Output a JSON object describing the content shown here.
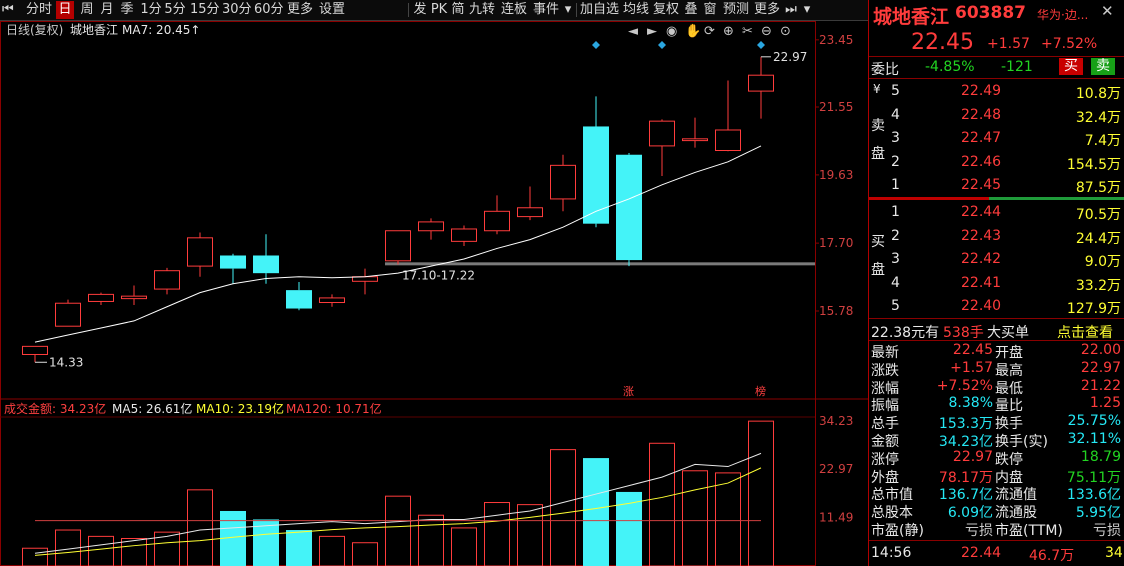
{
  "toolbar": {
    "periods": [
      "分时",
      "日",
      "周",
      "月",
      "季",
      "1分",
      "5分",
      "15分",
      "30分",
      "60分",
      "更多",
      "设置"
    ],
    "active_period": "日",
    "tools": [
      "发",
      "PK",
      "简",
      "九转",
      "连板",
      "事件",
      "▾",
      "加自选",
      "均线",
      "复权",
      "叠",
      "窗",
      "预测",
      "更多"
    ]
  },
  "chart": {
    "mode_label": "日线(复权)",
    "stock_name": "城地香江",
    "ma_label": "MA7: 20.45↑",
    "price_ticks": [
      "23.45",
      "21.55",
      "19.63",
      "17.70",
      "15.78"
    ],
    "high_label": "22.97",
    "low_label": "14.33",
    "gap_label": "17.10-17.22",
    "markers": [
      "涨",
      "榜"
    ],
    "vol_ticks": [
      "34.23",
      "22.97",
      "11.49"
    ],
    "vol_legend": {
      "label": "成交金额: 34.23亿",
      "ma5": "MA5: 26.61亿",
      "ma10": "MA10: 23.19亿",
      "ma120": "MA120: 10.71亿"
    },
    "colors": {
      "up": "#ff3c3c",
      "down": "#44f3f8",
      "ma": "#ffffff",
      "ma10": "#ffff33",
      "gap": "#7a7a7a"
    }
  },
  "chart_data": {
    "type": "candlestick",
    "title": "城地香江",
    "ylim": [
      14.3,
      23.45
    ],
    "candles": [
      {
        "o": 14.55,
        "h": 14.75,
        "l": 14.33,
        "c": 14.78
      },
      {
        "o": 15.35,
        "h": 16.1,
        "l": 15.35,
        "c": 16.0
      },
      {
        "o": 16.05,
        "h": 16.3,
        "l": 15.95,
        "c": 16.25
      },
      {
        "o": 16.13,
        "h": 16.5,
        "l": 15.95,
        "c": 16.2
      },
      {
        "o": 16.4,
        "h": 17.0,
        "l": 16.25,
        "c": 16.92
      },
      {
        "o": 17.05,
        "h": 18.0,
        "l": 16.75,
        "c": 17.85
      },
      {
        "o": 17.35,
        "h": 17.4,
        "l": 16.55,
        "c": 16.98
      },
      {
        "o": 17.35,
        "h": 17.95,
        "l": 16.55,
        "c": 16.85
      },
      {
        "o": 16.37,
        "h": 16.6,
        "l": 15.8,
        "c": 15.85
      },
      {
        "o": 16.02,
        "h": 16.25,
        "l": 15.9,
        "c": 16.15
      },
      {
        "o": 16.62,
        "h": 16.98,
        "l": 16.25,
        "c": 16.75
      },
      {
        "o": 17.2,
        "h": 18.05,
        "l": 17.1,
        "c": 18.05
      },
      {
        "o": 18.05,
        "h": 18.4,
        "l": 17.8,
        "c": 18.3
      },
      {
        "o": 17.75,
        "h": 18.2,
        "l": 17.62,
        "c": 18.1
      },
      {
        "o": 18.05,
        "h": 19.05,
        "l": 17.95,
        "c": 18.6
      },
      {
        "o": 18.45,
        "h": 19.3,
        "l": 18.35,
        "c": 18.7
      },
      {
        "o": 18.95,
        "h": 20.2,
        "l": 18.6,
        "c": 19.9
      },
      {
        "o": 21.0,
        "h": 21.85,
        "l": 18.15,
        "c": 18.25
      },
      {
        "o": 20.2,
        "h": 20.25,
        "l": 17.05,
        "c": 17.22
      },
      {
        "o": 20.45,
        "h": 21.2,
        "l": 19.6,
        "c": 21.15
      },
      {
        "o": 20.6,
        "h": 21.25,
        "l": 20.4,
        "c": 20.65
      },
      {
        "o": 20.32,
        "h": 22.3,
        "l": 20.3,
        "c": 20.9
      },
      {
        "o": 22.0,
        "h": 22.97,
        "l": 21.22,
        "c": 22.45
      }
    ],
    "ma7": [
      14.9,
      15.1,
      15.3,
      15.5,
      15.9,
      16.3,
      16.55,
      16.7,
      16.75,
      16.72,
      16.75,
      16.85,
      17.05,
      17.25,
      17.55,
      17.8,
      18.15,
      18.6,
      18.95,
      19.35,
      19.7,
      20.0,
      20.45
    ],
    "volume": [
      4.2,
      8.5,
      7.0,
      6.5,
      8.0,
      18.0,
      13.0,
      11.0,
      8.5,
      7.0,
      5.5,
      16.5,
      12.0,
      9.0,
      15.0,
      14.5,
      27.5,
      25.5,
      17.5,
      29.0,
      22.5,
      22.0,
      34.23
    ],
    "vol_ma5": [
      3.0,
      4.0,
      5.0,
      6.0,
      7.0,
      8.5,
      9.0,
      9.5,
      10.0,
      10.5,
      10.0,
      10.5,
      11.0,
      11.0,
      12.0,
      13.0,
      15.0,
      17.0,
      19.0,
      21.0,
      24.0,
      23.5,
      26.61
    ],
    "vol_ma10": [
      2.5,
      3.2,
      4.0,
      4.8,
      5.5,
      6.0,
      6.8,
      7.5,
      8.0,
      8.6,
      9.0,
      9.3,
      9.7,
      10.0,
      10.6,
      11.5,
      12.5,
      13.6,
      14.8,
      16.2,
      18.0,
      19.6,
      23.19
    ],
    "vol_ma120": [
      10.71
    ]
  },
  "quote": {
    "name": "城地香江",
    "code": "603887",
    "sector": "华为·边...",
    "price": "22.45",
    "change": "+1.57",
    "change_pct": "+7.52%",
    "weibi_label": "委比",
    "weibi_pct": "-4.85%",
    "weibi_diff": "-121",
    "buy_btn": "买",
    "sell_btn": "卖",
    "ask_label": "卖盘",
    "bid_label": "买盘",
    "asks": [
      {
        "lvl": "5",
        "price": "22.49",
        "vol": "10.8万"
      },
      {
        "lvl": "4",
        "price": "22.48",
        "vol": "32.4万"
      },
      {
        "lvl": "3",
        "price": "22.47",
        "vol": "7.4万"
      },
      {
        "lvl": "2",
        "price": "22.46",
        "vol": "154.5万"
      },
      {
        "lvl": "1",
        "price": "22.45",
        "vol": "87.5万"
      }
    ],
    "bids": [
      {
        "lvl": "1",
        "price": "22.44",
        "vol": "70.5万"
      },
      {
        "lvl": "2",
        "price": "22.43",
        "vol": "24.4万"
      },
      {
        "lvl": "3",
        "price": "22.42",
        "vol": "9.0万"
      },
      {
        "lvl": "4",
        "price": "22.41",
        "vol": "33.2万"
      },
      {
        "lvl": "5",
        "price": "22.40",
        "vol": "127.9万"
      }
    ],
    "big_order": {
      "price": "22.38元有",
      "hands": "538手",
      "label": "大买单",
      "link": "点击查看"
    },
    "stats": [
      {
        "k1": "最新",
        "v1": "22.45",
        "c1": "red",
        "k2": "开盘",
        "v2": "22.00",
        "c2": "red"
      },
      {
        "k1": "涨跌",
        "v1": "+1.57",
        "c1": "red",
        "k2": "最高",
        "v2": "22.97",
        "c2": "red"
      },
      {
        "k1": "涨幅",
        "v1": "+7.52%",
        "c1": "red",
        "k2": "最低",
        "v2": "21.22",
        "c2": "red"
      },
      {
        "k1": "振幅",
        "v1": "8.38%",
        "c1": "cyan",
        "k2": "量比",
        "v2": "1.25",
        "c2": "red"
      },
      {
        "k1": "总手",
        "v1": "153.3万",
        "c1": "cyan",
        "k2": "换手",
        "v2": "25.75%",
        "c2": "cyan"
      },
      {
        "k1": "金额",
        "v1": "34.23亿",
        "c1": "cyan",
        "k2": "换手(实)",
        "v2": "32.11%",
        "c2": "cyan"
      },
      {
        "k1": "涨停",
        "v1": "22.97",
        "c1": "red",
        "k2": "跌停",
        "v2": "18.79",
        "c2": "green"
      },
      {
        "k1": "外盘",
        "v1": "78.17万",
        "c1": "red",
        "k2": "内盘",
        "v2": "75.11万",
        "c2": "green"
      },
      {
        "k1": "总市值",
        "v1": "136.7亿",
        "c1": "cyan",
        "k2": "流通值",
        "v2": "133.6亿",
        "c2": "cyan"
      },
      {
        "k1": "总股本",
        "v1": "6.09亿",
        "c1": "cyan",
        "k2": "流通股",
        "v2": "5.95亿",
        "c2": "cyan"
      },
      {
        "k1": "市盈(静)",
        "v1": "亏损",
        "c1": "gray",
        "k2": "市盈(TTM)",
        "v2": "亏损",
        "c2": "gray"
      }
    ],
    "tick": {
      "time": "14:56",
      "price": "22.44",
      "vol": "46.7万",
      "count": "34"
    }
  }
}
